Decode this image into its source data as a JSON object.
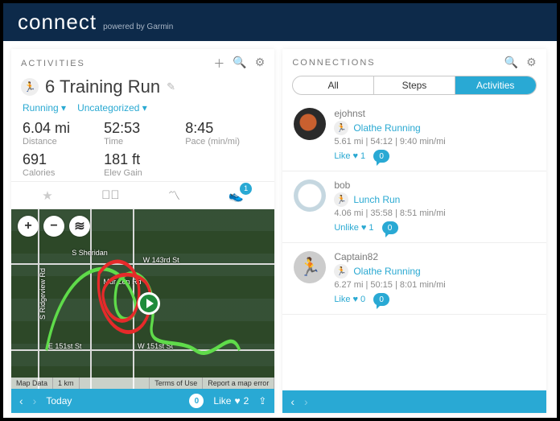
{
  "header": {
    "brand": "connect",
    "sub": "powered by Garmin"
  },
  "activities": {
    "title": "ACTIVITIES",
    "name": "6 Training Run",
    "type_label": "Running ▾",
    "category_label": "Uncategorized ▾",
    "stats": {
      "distance": {
        "v": "6.04 mi",
        "l": "Distance"
      },
      "time": {
        "v": "52:53",
        "l": "Time"
      },
      "pace": {
        "v": "8:45",
        "l": "Pace (min/mi)"
      },
      "calories": {
        "v": "691",
        "l": "Calories"
      },
      "elev": {
        "v": "181 ft",
        "l": "Elev Gain"
      }
    },
    "gear_count": "1",
    "map": {
      "attrib": {
        "data": "Map Data",
        "scale": "1 km",
        "terms": "Terms of Use",
        "report": "Report a map error"
      },
      "labels": {
        "l1": "S Ridgeview Rd",
        "l2": "S Sheridan",
        "l3": "Mur Len Rd",
        "l4": "W 143rd St",
        "l5": "E 151st St",
        "l6": "W 151st St"
      }
    },
    "footer": {
      "today": "Today",
      "comments": "0",
      "likes_label": "Like",
      "likes_count": "2"
    }
  },
  "connections": {
    "title": "CONNECTIONS",
    "tabs": {
      "all": "All",
      "steps": "Steps",
      "activities": "Activities"
    },
    "items": [
      {
        "user": "ejohnst",
        "activity": "Olathe Running",
        "meta": "5.61 mi | 54:12 | 9:40 min/mi",
        "like": "Like",
        "likecount": "1",
        "comments": "0"
      },
      {
        "user": "bob",
        "activity": "Lunch Run",
        "meta": "4.06 mi | 35:58 | 8:51 min/mi",
        "like": "Unlike",
        "likecount": "1",
        "comments": "0"
      },
      {
        "user": "Captain82",
        "activity": "Olathe Running",
        "meta": "6.27 mi | 50:15 | 8:01 min/mi",
        "like": "Like",
        "likecount": "0",
        "comments": "0"
      }
    ]
  }
}
